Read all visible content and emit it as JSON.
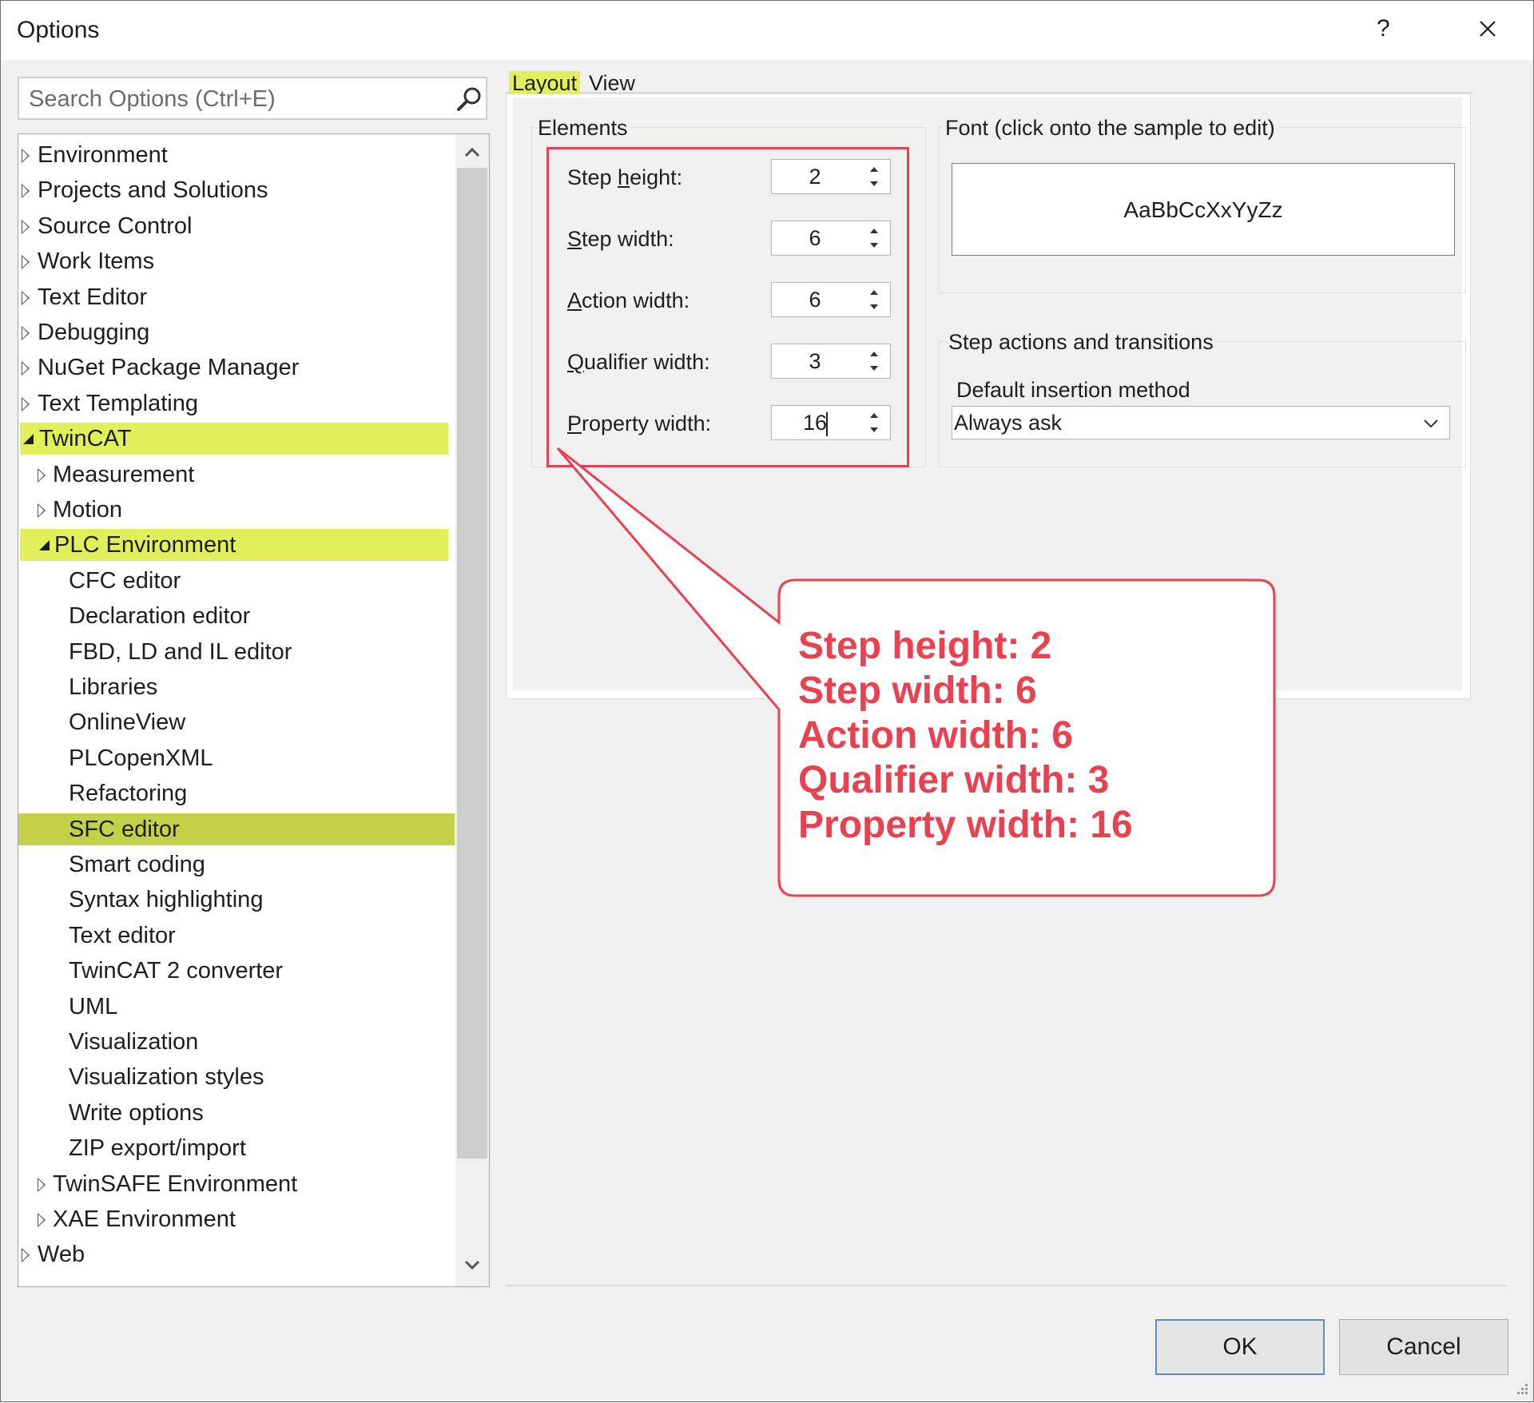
{
  "window": {
    "title": "Options",
    "help_label": "?"
  },
  "search": {
    "placeholder": "Search Options (Ctrl+E)"
  },
  "tree": {
    "items": [
      {
        "label": "Environment",
        "level": 0,
        "state": "collapsed"
      },
      {
        "label": "Projects and Solutions",
        "level": 0,
        "state": "collapsed"
      },
      {
        "label": "Source Control",
        "level": 0,
        "state": "collapsed"
      },
      {
        "label": "Work Items",
        "level": 0,
        "state": "collapsed"
      },
      {
        "label": "Text Editor",
        "level": 0,
        "state": "collapsed"
      },
      {
        "label": "Debugging",
        "level": 0,
        "state": "collapsed"
      },
      {
        "label": "NuGet Package Manager",
        "level": 0,
        "state": "collapsed"
      },
      {
        "label": "Text Templating",
        "level": 0,
        "state": "collapsed"
      },
      {
        "label": "TwinCAT",
        "level": 0,
        "state": "expanded",
        "highlight": "yellow"
      },
      {
        "label": "Measurement",
        "level": 1,
        "state": "collapsed"
      },
      {
        "label": "Motion",
        "level": 1,
        "state": "collapsed"
      },
      {
        "label": "PLC Environment",
        "level": 1,
        "state": "expanded",
        "highlight": "yellow"
      },
      {
        "label": "CFC editor",
        "level": 2,
        "state": "leaf"
      },
      {
        "label": "Declaration editor",
        "level": 2,
        "state": "leaf"
      },
      {
        "label": "FBD, LD and IL editor",
        "level": 2,
        "state": "leaf"
      },
      {
        "label": "Libraries",
        "level": 2,
        "state": "leaf"
      },
      {
        "label": "OnlineView",
        "level": 2,
        "state": "leaf"
      },
      {
        "label": "PLCopenXML",
        "level": 2,
        "state": "leaf"
      },
      {
        "label": "Refactoring",
        "level": 2,
        "state": "leaf"
      },
      {
        "label": "SFC editor",
        "level": 2,
        "state": "leaf",
        "highlight": "selected"
      },
      {
        "label": "Smart coding",
        "level": 2,
        "state": "leaf"
      },
      {
        "label": "Syntax highlighting",
        "level": 2,
        "state": "leaf"
      },
      {
        "label": "Text editor",
        "level": 2,
        "state": "leaf"
      },
      {
        "label": "TwinCAT 2 converter",
        "level": 2,
        "state": "leaf"
      },
      {
        "label": "UML",
        "level": 2,
        "state": "leaf"
      },
      {
        "label": "Visualization",
        "level": 2,
        "state": "leaf"
      },
      {
        "label": "Visualization styles",
        "level": 2,
        "state": "leaf"
      },
      {
        "label": "Write options",
        "level": 2,
        "state": "leaf"
      },
      {
        "label": "ZIP export/import",
        "level": 2,
        "state": "leaf"
      },
      {
        "label": "TwinSAFE Environment",
        "level": 1,
        "state": "collapsed"
      },
      {
        "label": "XAE Environment",
        "level": 1,
        "state": "collapsed"
      },
      {
        "label": "Web",
        "level": 0,
        "state": "collapsed"
      }
    ]
  },
  "tabs": {
    "layout": "Layout",
    "view": "View"
  },
  "elements": {
    "title": "Elements",
    "step_height": {
      "pre": "Step ",
      "key": "h",
      "post": "eight:",
      "value": "2"
    },
    "step_width": {
      "key": "S",
      "post": "tep width:",
      "value": "6"
    },
    "action_width": {
      "key": "A",
      "post": "ction width:",
      "value": "6"
    },
    "qualifier_width": {
      "key": "Q",
      "post": "ualifier width:",
      "value": "3"
    },
    "property_width": {
      "key": "P",
      "post": "roperty width:",
      "value": "16"
    }
  },
  "font": {
    "title": "Font (click onto the sample to edit)",
    "sample": "AaBbCcXxYyZz"
  },
  "step_actions": {
    "title": "Step actions and transitions",
    "insertion_label": "Default insertion method",
    "insertion_value": "Always ask"
  },
  "callout": {
    "lines": [
      "Step height: 2",
      "Step width: 6",
      "Action width: 6",
      "Qualifier width: 3",
      "Property width: 16"
    ]
  },
  "buttons": {
    "ok": "OK",
    "cancel": "Cancel"
  },
  "colors": {
    "highlight": "#e1f05a",
    "selected": "#c2d147",
    "annotation": "#e8414f",
    "ok_border": "#5b8fc9"
  },
  "icons": {
    "search": "search-icon",
    "close": "close-icon",
    "help": "help-icon"
  }
}
